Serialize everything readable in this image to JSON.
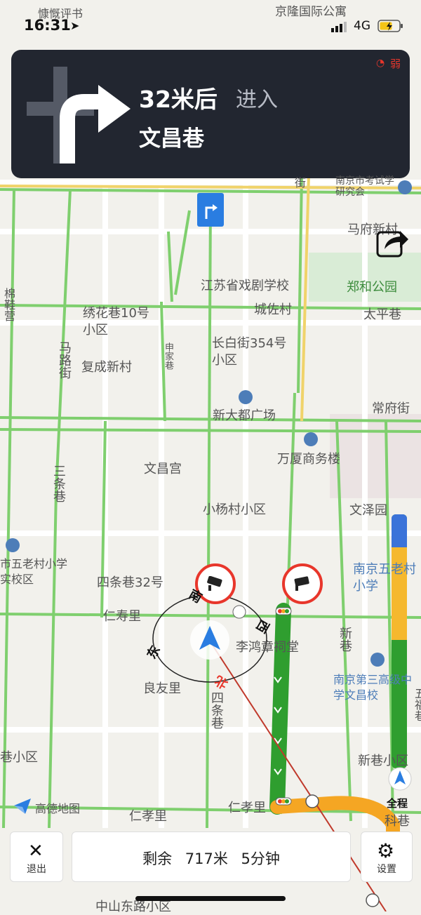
{
  "status_bar": {
    "time": "16:31",
    "network": "4G"
  },
  "navigation": {
    "distance": "32米后",
    "action": "进入",
    "road": "文昌巷",
    "signal": "弱"
  },
  "map_labels": [
    {
      "id": "l1",
      "text": "慷慨评书"
    },
    {
      "id": "l2",
      "text": "京隆国际公寓"
    },
    {
      "id": "l3",
      "text": "南京市考试学研究会"
    },
    {
      "id": "l4",
      "text": "马府新村"
    },
    {
      "id": "l5",
      "text": "江苏省戏剧学校"
    },
    {
      "id": "l6",
      "text": "郑和公园"
    },
    {
      "id": "l7",
      "text": "城佐村"
    },
    {
      "id": "l8",
      "text": "太平巷"
    },
    {
      "id": "l9",
      "text": "绣花巷10号小区"
    },
    {
      "id": "l10",
      "text": "长白街354号小区"
    },
    {
      "id": "l11",
      "text": "复成新村"
    },
    {
      "id": "l12",
      "text": "新大都广场"
    },
    {
      "id": "l13",
      "text": "常府街"
    },
    {
      "id": "l14",
      "text": "万厦商务楼"
    },
    {
      "id": "l15",
      "text": "文昌宫"
    },
    {
      "id": "l16",
      "text": "小杨村小区"
    },
    {
      "id": "l17",
      "text": "文泽园"
    },
    {
      "id": "l18",
      "text": "市五老村小学实校区"
    },
    {
      "id": "l19",
      "text": "南京五老村小学"
    },
    {
      "id": "l20",
      "text": "四条巷32号"
    },
    {
      "id": "l21",
      "text": "仁寿里"
    },
    {
      "id": "l22",
      "text": "李鸿章祠堂"
    },
    {
      "id": "l23",
      "text": "良友里"
    },
    {
      "id": "l24",
      "text": "南京第三高级中学文昌校"
    },
    {
      "id": "l25",
      "text": "新巷小区"
    },
    {
      "id": "l26",
      "text": "巷小区"
    },
    {
      "id": "l27",
      "text": "仁孝里"
    },
    {
      "id": "l28",
      "text": "科巷"
    },
    {
      "id": "l29",
      "text": "中山东路小区"
    },
    {
      "id": "v1",
      "text": "马路街"
    },
    {
      "id": "v2",
      "text": "三条巷"
    },
    {
      "id": "v3",
      "text": "四条巷"
    },
    {
      "id": "v4",
      "text": "新巷"
    },
    {
      "id": "v5",
      "text": "申家巷"
    },
    {
      "id": "v6",
      "text": "棉鞋营"
    },
    {
      "id": "v7",
      "text": "五福巷"
    },
    {
      "id": "v8",
      "text": "街"
    }
  ],
  "compass": {
    "south": "南",
    "west": "西",
    "east": "东",
    "north": "北"
  },
  "map_logo": "高德地图",
  "progress_bar": {
    "label": "全程"
  },
  "bottom": {
    "exit": "退出",
    "remain_label": "剩余",
    "remain_distance": "717米",
    "remain_time": "5分钟",
    "settings": "设置"
  },
  "colors": {
    "card_bg": "#222630",
    "road_green": "#4aae4a",
    "route_orange": "#f5a623",
    "camera_red": "#e8362b",
    "position_blue": "#2a7de1"
  }
}
